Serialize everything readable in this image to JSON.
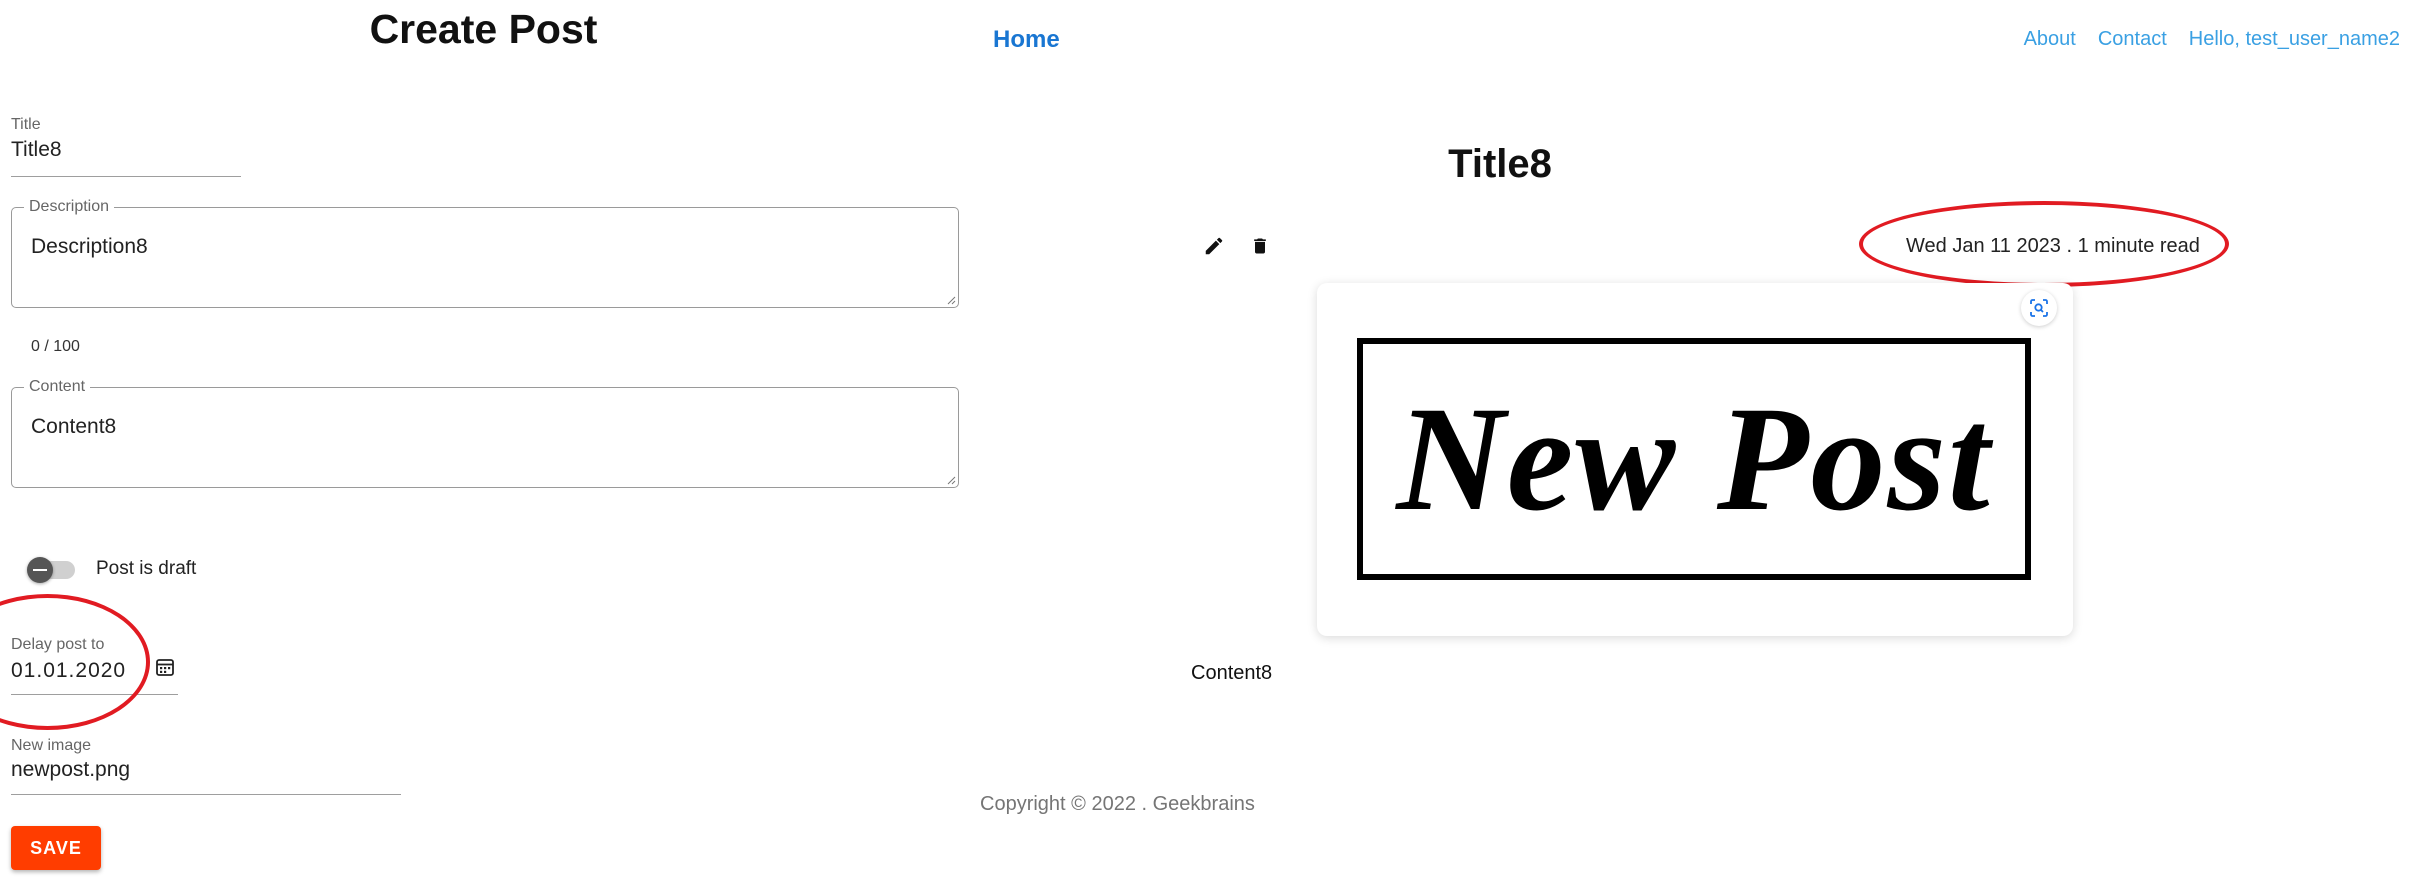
{
  "form": {
    "heading": "Create Post",
    "title": {
      "label": "Title",
      "value": "Title8"
    },
    "description": {
      "label": "Description",
      "value": "Description8",
      "counter": "0 / 100"
    },
    "content": {
      "label": "Content",
      "value": "Content8"
    },
    "draft_switch": {
      "label": "Post is draft",
      "checked": false
    },
    "delay": {
      "label": "Delay post to",
      "value": "01.01.2020"
    },
    "new_image": {
      "label": "New image",
      "value": "newpost.png"
    },
    "save_label": "SAVE"
  },
  "nav": {
    "home": "Home",
    "links": [
      "About",
      "Contact",
      "Hello, test_user_name2"
    ]
  },
  "post": {
    "title": "Title8",
    "meta": "Wed Jan 11 2023 . 1 minute read",
    "image_text": "New Post",
    "content": "Content8"
  },
  "footer": {
    "copyright": "Copyright © 2022 . Geekbrains"
  },
  "icons": {
    "edit": "pencil-icon",
    "delete": "trash-icon",
    "calendar": "calendar-icon",
    "lens": "focus-search-icon"
  },
  "colors": {
    "primary": "#1976d2",
    "link": "#3aa0e3",
    "save_button": "#ff3d00",
    "annotation": "#e11b22"
  }
}
